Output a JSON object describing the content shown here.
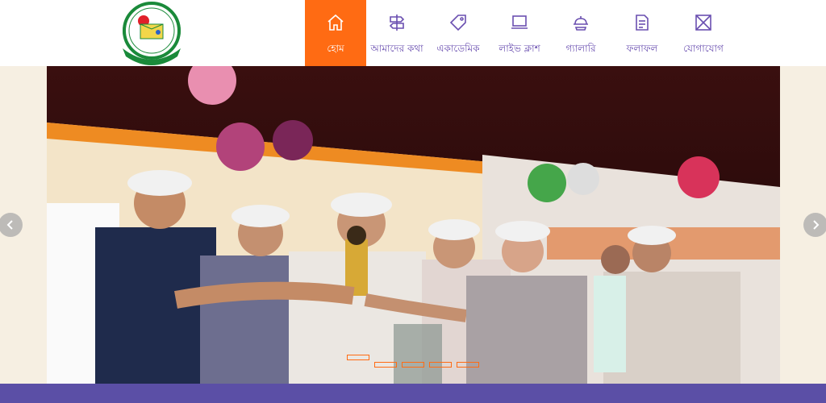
{
  "nav": {
    "items": [
      {
        "label": "হোম",
        "icon": "home-icon",
        "active": true
      },
      {
        "label": "আমাদের কথা",
        "icon": "signpost-icon",
        "active": false
      },
      {
        "label": "একাডেমিক",
        "icon": "tag-icon",
        "active": false
      },
      {
        "label": "লাইভ ক্লাশ",
        "icon": "laptop-icon",
        "active": false
      },
      {
        "label": "গ্যালারি",
        "icon": "dish-icon",
        "active": false
      },
      {
        "label": "ফলাফল",
        "icon": "document-icon",
        "active": false
      },
      {
        "label": "যোগাযোগ",
        "icon": "contact-box-icon",
        "active": false
      }
    ]
  },
  "carousel": {
    "slide_count": 5,
    "active_slide": 1
  },
  "colors": {
    "accent": "#ff6b13",
    "nav_text": "#6a4fb0",
    "band": "#5b4fa6",
    "stage_bg": "#f6efe2"
  }
}
